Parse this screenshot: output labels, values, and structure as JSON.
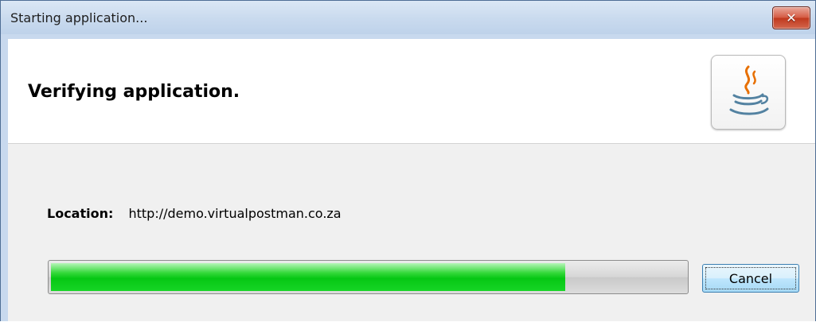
{
  "window": {
    "title": "Starting application...",
    "close_icon": "close-icon"
  },
  "header": {
    "title": "Verifying application.",
    "logo_icon": "java-coffee-cup-icon"
  },
  "content": {
    "location_label": "Location:",
    "location_value": "http://demo.virtualpostman.co.za",
    "progress_fraction": 0.81,
    "cancel_label": "Cancel"
  },
  "colors": {
    "progress_fill": "#06c714",
    "close_button": "#c0391e",
    "titlebar": "#c9daee",
    "panel": "#f0f0f0"
  }
}
